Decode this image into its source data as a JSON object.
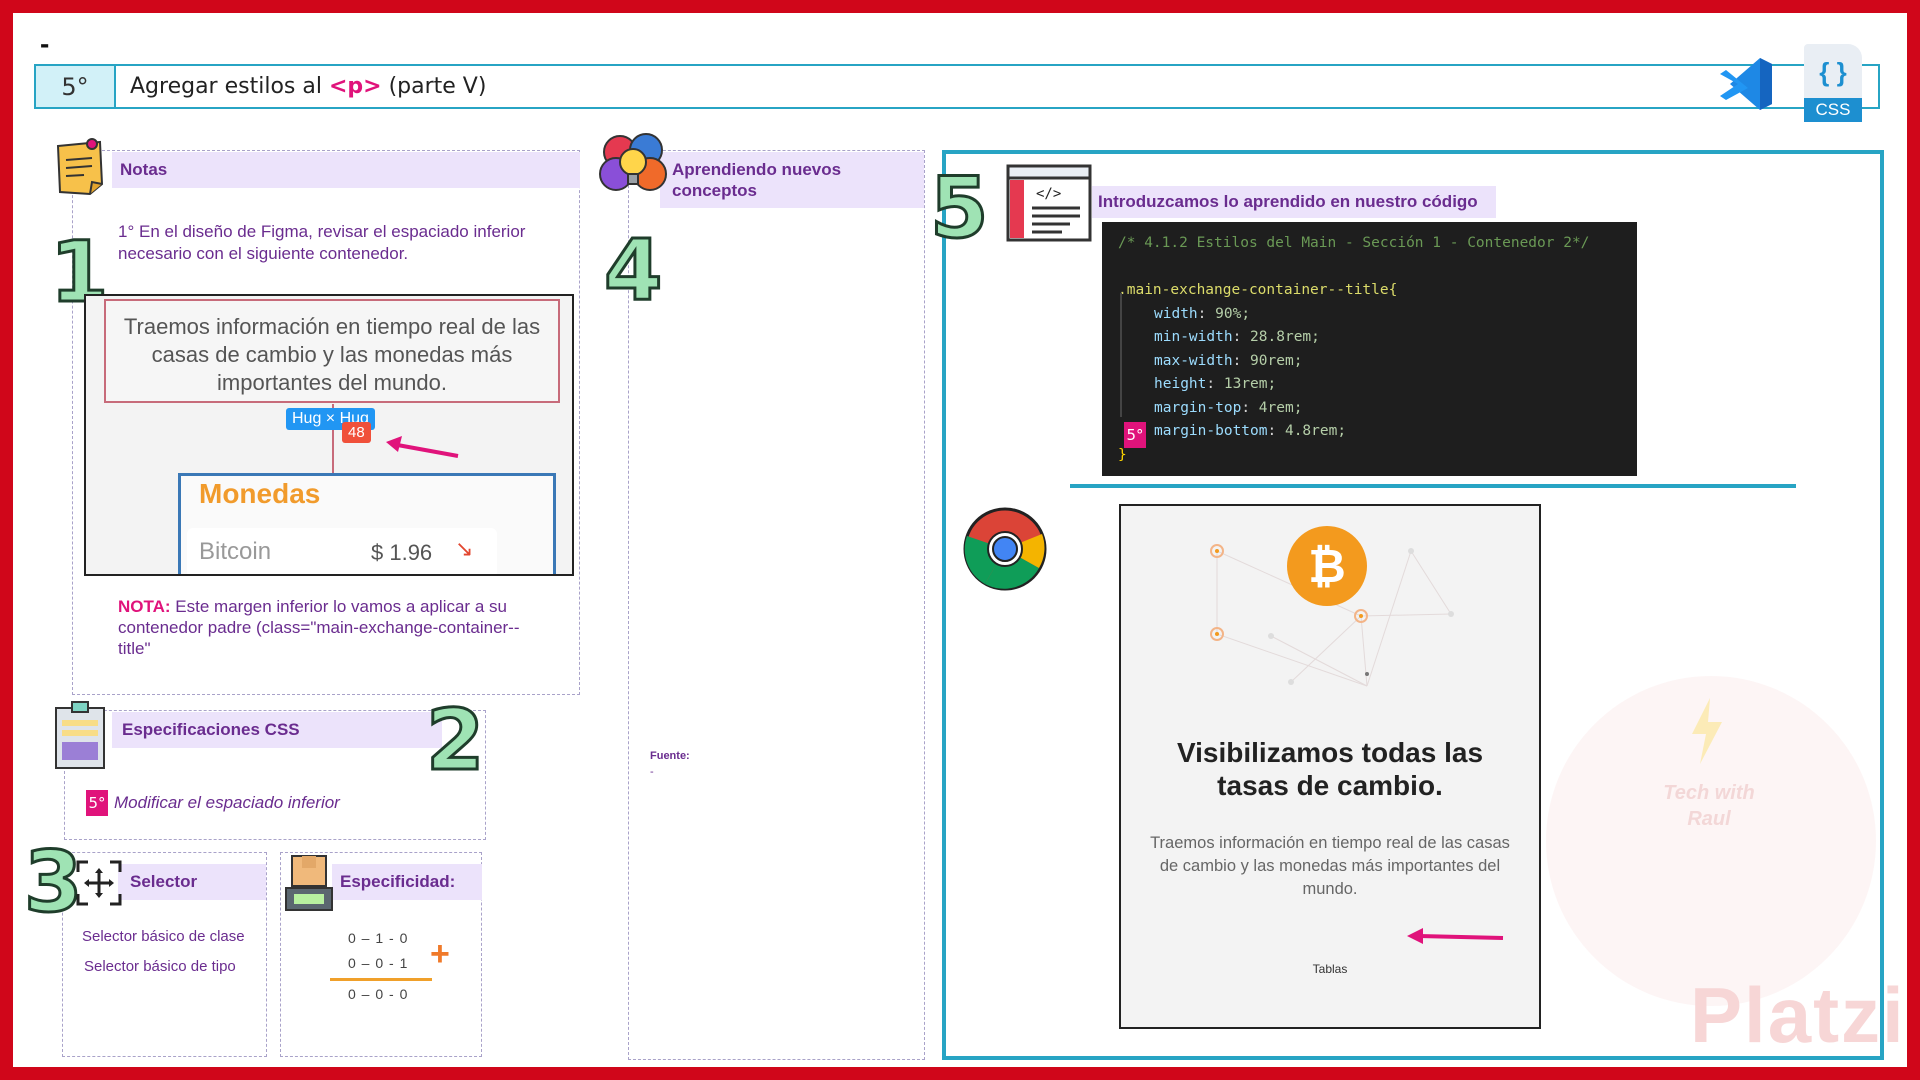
{
  "top_dash": "-",
  "header": {
    "step": "5°",
    "title_before": "Agregar estilos al",
    "title_tag": "<p>",
    "title_after": "(parte V)",
    "css_label": "CSS",
    "css_braces": "{ }"
  },
  "notes": {
    "title": "Notas",
    "number": "1",
    "item1": "1° En el diseño de Figma, revisar el espaciado inferior necesario con el siguiente contenedor.",
    "figma_text": "Traemos información en tiempo real de las casas de cambio y las monedas más importantes del mundo.",
    "hug_label": "Hug × Hug",
    "spacing_value": "48",
    "monedas": "Monedas",
    "coin": "Bitcoin",
    "price": "$ 1.96",
    "trend": "↘",
    "nota_label": "NOTA:",
    "nota_text": "Este margen inferior lo vamos a aplicar a su contenedor padre (class=\"main-exchange-container--title\""
  },
  "concepts": {
    "title": "Aprendiendo nuevos conceptos",
    "number": "4",
    "fuente_label": "Fuente:",
    "fuente_value": "-"
  },
  "specs": {
    "title": "Especificaciones CSS",
    "number": "2",
    "badge": "5°",
    "item": "Modificar el espaciado inferior"
  },
  "selector": {
    "number": "3",
    "title": "Selector",
    "items": [
      "Selector básico de clase",
      "Selector básico de tipo"
    ]
  },
  "specificity": {
    "title": "Especificidad:",
    "line1": "0 – 1 - 0",
    "line2": "0 – 0 - 1",
    "result": "0 – 0 - 0",
    "plus": "+"
  },
  "code_section": {
    "number": "5",
    "title": "Introduzcamos lo aprendido en nuestro código",
    "comment": "/* 4.1.2 Estilos del Main - Sección 1 - Contenedor 2*/",
    "selector": ".main-exchange-container--title{",
    "props": [
      {
        "name": "width",
        "value": "90%;"
      },
      {
        "name": "min-width",
        "value": "28.8rem;"
      },
      {
        "name": "max-width",
        "value": "90rem;"
      },
      {
        "name": "height",
        "value": "13rem;"
      },
      {
        "name": "margin-top",
        "value": "4rem;"
      },
      {
        "name": "margin-bottom",
        "value": "4.8rem;"
      }
    ],
    "close": "}",
    "badge": "5°"
  },
  "browser_mock": {
    "heading": "Visibilizamos todas las tasas de cambio.",
    "paragraph": "Traemos información en tiempo real de las casas de cambio y las monedas más importantes del mundo.",
    "tab": "Tablas",
    "coin_symbol": "₿"
  },
  "watermark": {
    "text": "Platzi",
    "badge": "Tech with Raul"
  },
  "colors": {
    "frame": "#d0061a",
    "accent_teal": "#27a4c4",
    "magenta": "#e0137b",
    "purple": "#6a2c8f",
    "lavender": "#ece3fb"
  }
}
